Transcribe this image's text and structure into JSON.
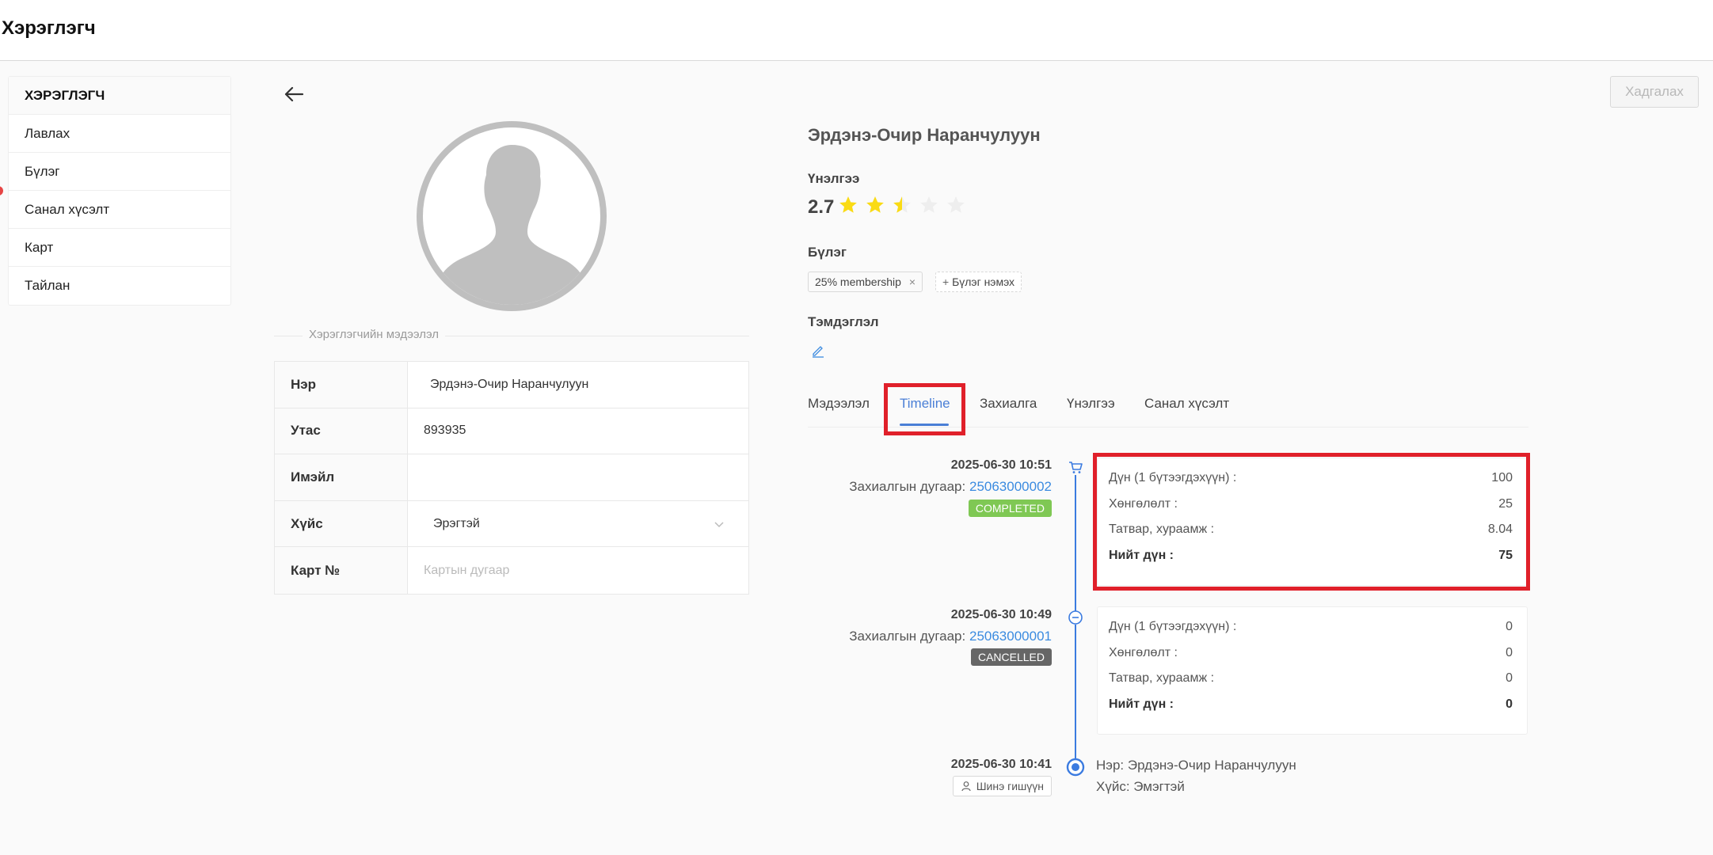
{
  "header": {
    "title": "Хэрэглэгч"
  },
  "sidebar": {
    "title": "ХЭРЭГЛЭГЧ",
    "items": [
      {
        "label": "Лавлах"
      },
      {
        "label": "Бүлэг"
      },
      {
        "label": "Санал хүсэлт"
      },
      {
        "label": "Карт"
      },
      {
        "label": "Тайлан"
      }
    ]
  },
  "toolbar": {
    "save_label": "Хадгалах"
  },
  "profile": {
    "section_label": "Хэрэглэгчийн мэдээлэл",
    "fields": [
      {
        "label": "Нэр",
        "value": "Эрдэнэ-Очир  Наранчулуун"
      },
      {
        "label": "Утас",
        "value": "893935"
      },
      {
        "label": "Имэйл",
        "value": ""
      },
      {
        "label": "Хүйс",
        "value": "Эрэгтэй"
      },
      {
        "label": "Карт №",
        "placeholder": "Картын дугаар"
      }
    ],
    "name": "Эрдэнэ-Очир Наранчулуун",
    "rating_label": "Үнэлгээ",
    "rating": "2.7",
    "rating_fraction": 0.54,
    "group_label": "Бүлэг",
    "group_tag": "25% membership",
    "add_group_label": "Бүлэг нэмэх",
    "note_label": "Тэмдэглэл"
  },
  "tabs": [
    {
      "label": "Мэдээлэл"
    },
    {
      "label": "Timeline",
      "active": true
    },
    {
      "label": "Захиалга"
    },
    {
      "label": "Үнэлгээ"
    },
    {
      "label": "Санал хүсэлт"
    }
  ],
  "timeline": {
    "events": [
      {
        "date": "2025-06-30 10:51",
        "order_label": "Захиалгын дугаар:",
        "order_no": "25063000002",
        "status": "COMPLETED",
        "rows": [
          {
            "label": "Дүн (1 бүтээгдэхүүн) :",
            "value": "100"
          },
          {
            "label": "Хөнгөлөлт :",
            "value": "25"
          },
          {
            "label": "Татвар, хураамж :",
            "value": "8.04"
          },
          {
            "label": "Нийт дүн :",
            "value": "75"
          }
        ]
      },
      {
        "date": "2025-06-30 10:49",
        "order_label": "Захиалгын дугаар:",
        "order_no": "25063000001",
        "status": "CANCELLED",
        "rows": [
          {
            "label": "Дүн (1 бүтээгдэхүүн) :",
            "value": "0"
          },
          {
            "label": "Хөнгөлөлт :",
            "value": "0"
          },
          {
            "label": "Татвар, хураамж :",
            "value": "0"
          },
          {
            "label": "Нийт дүн :",
            "value": "0"
          }
        ]
      },
      {
        "date": "2025-06-30 10:41",
        "status": "Шинэ гишүүн",
        "name_line": "Нэр: Эрдэнэ-Очир Наранчулуун",
        "gender_line": "Хүйс: Эмэгтэй"
      }
    ]
  },
  "colors": {
    "accent": "#4a7fd6",
    "completed": "#7fc854",
    "cancelled": "#666666",
    "highlight": "#e0202a",
    "star": "#fadb14"
  }
}
